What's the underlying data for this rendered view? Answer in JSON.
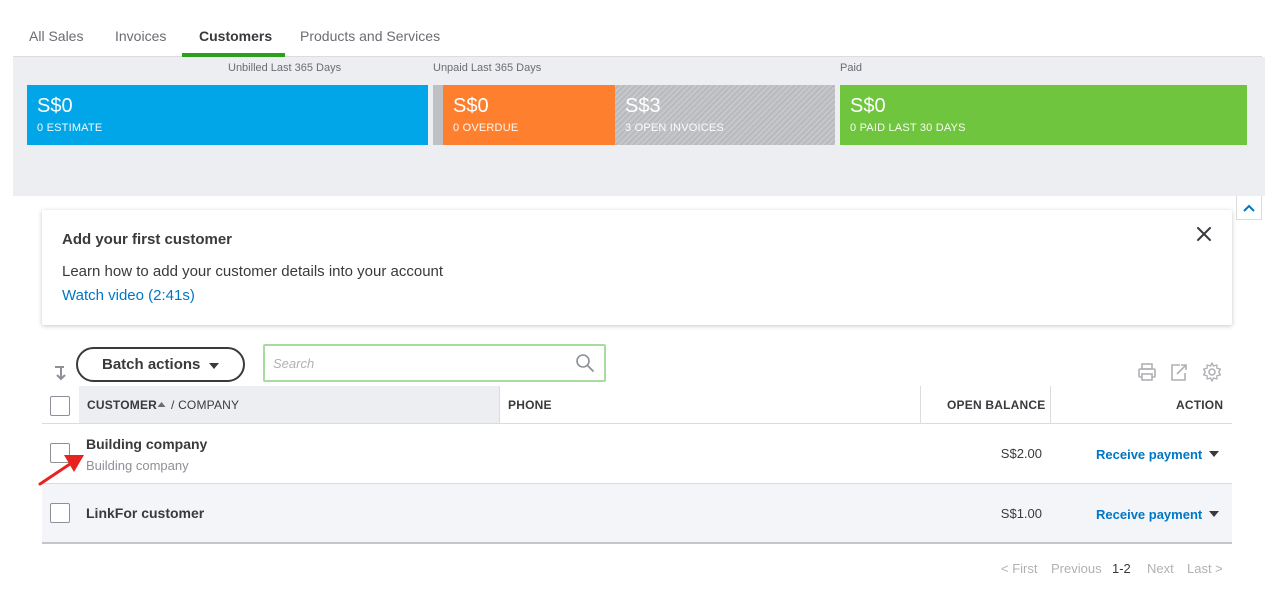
{
  "tabs": [
    {
      "label": "All Sales"
    },
    {
      "label": "Invoices"
    },
    {
      "label": "Customers"
    },
    {
      "label": "Products and Services"
    }
  ],
  "active_tab": "Customers",
  "money_bar": {
    "labels": {
      "unbilled": "Unbilled Last 365 Days",
      "unpaid": "Unpaid Last 365 Days",
      "paid": "Paid"
    },
    "segments": [
      {
        "amount": "S$0",
        "caption": "0 ESTIMATE",
        "color": "#00a6e7"
      },
      {
        "amount": "S$0",
        "caption": "0 OVERDUE",
        "color": "#fe7f2d"
      },
      {
        "amount": "S$3",
        "caption": "3 OPEN INVOICES",
        "color": "#bfc0c3"
      },
      {
        "amount": "S$0",
        "caption": "0 PAID LAST 30 DAYS",
        "color": "#6fc53d"
      }
    ]
  },
  "card": {
    "title": "Add your first customer",
    "description": "Learn how to add your customer details into your account",
    "link": "Watch video (2:41s)"
  },
  "toolbar": {
    "batch_label": "Batch actions",
    "search_placeholder": "Search"
  },
  "table": {
    "headers": {
      "customer": "CUSTOMER",
      "company": "/ COMPANY",
      "phone": "PHONE",
      "open_balance": "OPEN BALANCE",
      "action": "ACTION"
    },
    "rows": [
      {
        "name": "Building company",
        "company": "Building company",
        "phone": "",
        "balance": "S$2.00",
        "action": "Receive payment"
      },
      {
        "name": "LinkFor customer",
        "company": "",
        "phone": "",
        "balance": "S$1.00",
        "action": "Receive payment"
      }
    ]
  },
  "pagination": {
    "first": "< First",
    "previous": "Previous",
    "range": "1-2",
    "next": "Next",
    "last": "Last >"
  },
  "colors": {
    "brand_green": "#2ca01c",
    "link_blue": "#0077c5",
    "annotation_red": "#e8231f"
  }
}
